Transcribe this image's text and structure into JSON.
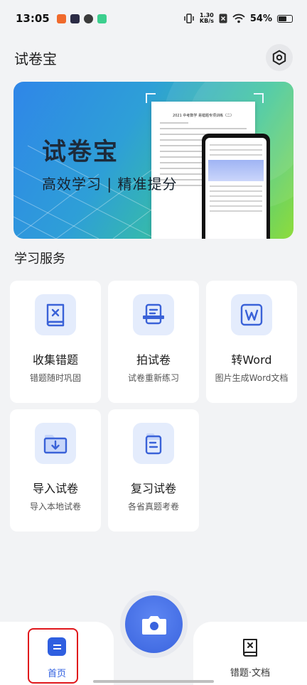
{
  "status_bar": {
    "time": "13:05",
    "net_speed_value": "1.30",
    "net_speed_unit": "KB/s",
    "battery": "54%"
  },
  "header": {
    "title": "试卷宝"
  },
  "banner": {
    "title": "试卷宝",
    "subtitle": "高效学习 | 精准提分",
    "paper_heading": "2021 中考数学 易错题专项训练（二）"
  },
  "services": {
    "title": "学习服务",
    "items": [
      {
        "title": "收集错题",
        "subtitle": "错题随时巩固",
        "icon": "mistake-book-icon"
      },
      {
        "title": "拍试卷",
        "subtitle": "试卷重新练习",
        "icon": "scan-paper-icon"
      },
      {
        "title": "转Word",
        "subtitle": "图片生成Word文档",
        "icon": "word-doc-icon"
      },
      {
        "title": "导入试卷",
        "subtitle": "导入本地试卷",
        "icon": "import-folder-icon"
      },
      {
        "title": "复习试卷",
        "subtitle": "各省真题考卷",
        "icon": "review-folder-icon"
      }
    ]
  },
  "bottom_nav": {
    "home_label": "首页",
    "mistakes_label": "错题·文档"
  },
  "colors": {
    "accent": "#2f5fe0",
    "highlight": "#e0161b",
    "background": "#f2f3f5"
  }
}
